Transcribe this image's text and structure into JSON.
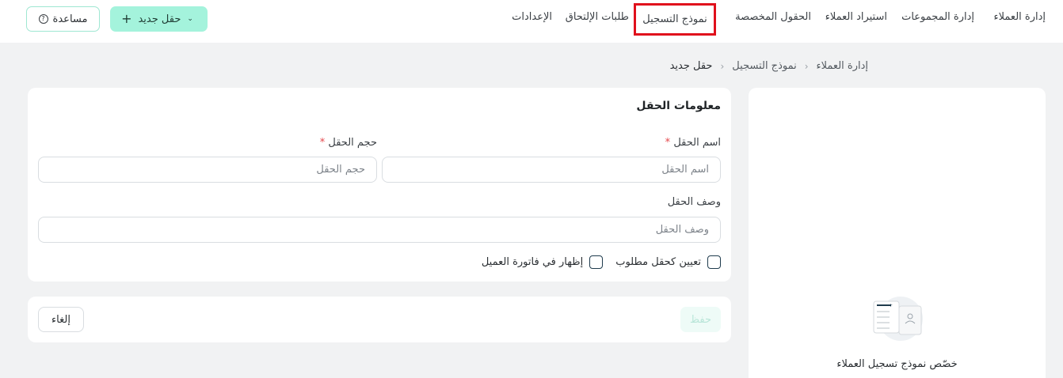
{
  "nav": {
    "items": [
      {
        "label": "إدارة العملاء"
      },
      {
        "label": "إدارة المجموعات"
      },
      {
        "label": "استيراد العملاء"
      },
      {
        "label": "الحقول المخصصة"
      },
      {
        "label": "نموذج التسجيل"
      },
      {
        "label": "طلبات الإلتحاق"
      },
      {
        "label": "الإعدادات"
      }
    ],
    "new_field_button": "حقل جديد",
    "help_button": "مساعدة"
  },
  "breadcrumb": [
    "إدارة العملاء",
    "نموذج التسجيل",
    "حقل جديد"
  ],
  "form": {
    "title": "معلومات الحقل",
    "field_name_label": "اسم الحقل",
    "field_name_placeholder": "اسم الحقل",
    "field_size_label": "حجم الحقل",
    "field_size_placeholder": "حجم الحقل",
    "description_label": "وصف الحقل",
    "description_placeholder": "وصف الحقل",
    "required_asterisk": "*",
    "checkbox_required": "تعيين كحقل مطلوب",
    "checkbox_show_invoice": "إظهار في فاتورة العميل"
  },
  "actions": {
    "save": "حفظ",
    "cancel": "إلغاء"
  },
  "side": {
    "caption": "خصّص نموذج تسجيل العملاء"
  },
  "colors": {
    "accent": "#a4f3dc",
    "highlight_outline": "#e0101c",
    "required": "#e5484d"
  },
  "icons": {
    "plus": "plus-icon",
    "chevron": "chevron-down-icon",
    "help": "help-circle-icon",
    "breadcrumb_sep": "chevron-left-icon"
  }
}
